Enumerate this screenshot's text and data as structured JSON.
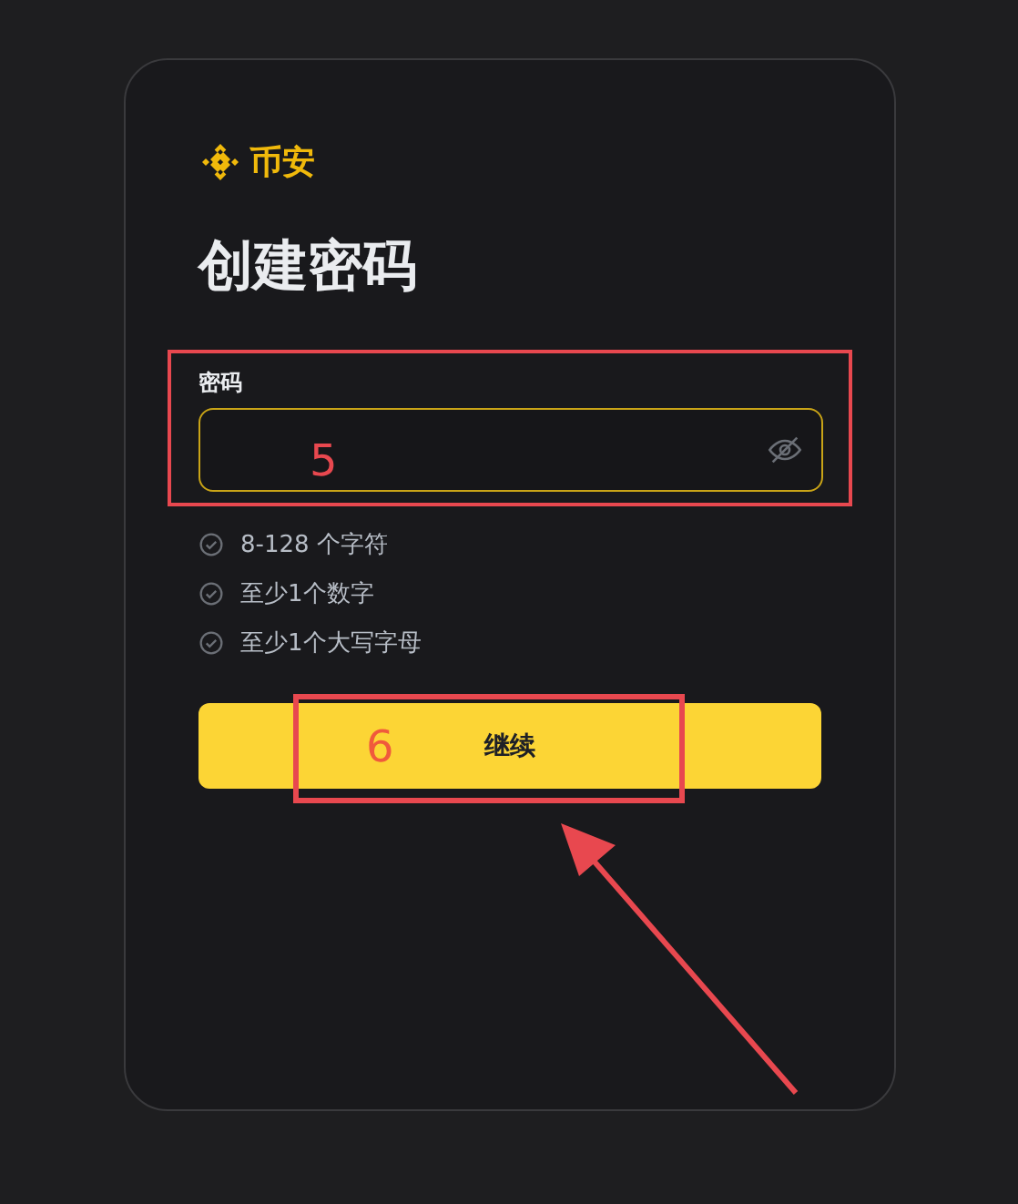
{
  "brand": {
    "name": "币安"
  },
  "title": "创建密码",
  "password": {
    "label": "密码",
    "visible": false
  },
  "requirements": [
    {
      "text": "8-128 个字符",
      "met": false
    },
    {
      "text": "至少1个数字",
      "met": false
    },
    {
      "text": "至少1个大写字母",
      "met": false
    }
  ],
  "submit": {
    "label": "继续"
  },
  "annotations": [
    {
      "number": "5"
    },
    {
      "number": "6"
    }
  ]
}
